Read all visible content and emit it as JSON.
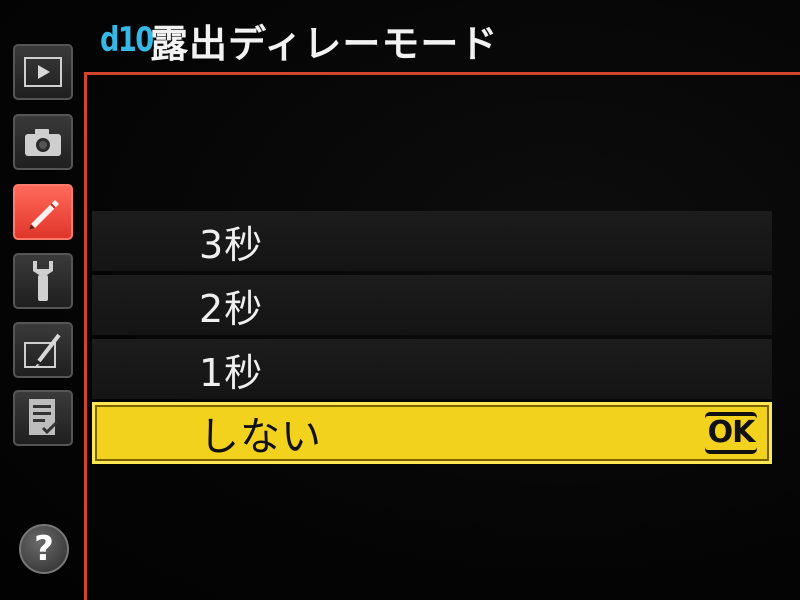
{
  "header": {
    "menu_code": "d10",
    "title": "露出ディレーモード"
  },
  "sidebar": {
    "items": [
      {
        "name": "playback-tab",
        "icon": "playback-icon",
        "active": false
      },
      {
        "name": "shooting-tab",
        "icon": "camera-icon",
        "active": false
      },
      {
        "name": "custom-settings-tab",
        "icon": "pencil-icon",
        "active": true
      },
      {
        "name": "setup-tab",
        "icon": "wrench-icon",
        "active": false
      },
      {
        "name": "retouch-tab",
        "icon": "retouch-brush-icon",
        "active": false
      },
      {
        "name": "my-menu-tab",
        "icon": "checklist-icon",
        "active": false
      }
    ],
    "help_label": "?"
  },
  "options": [
    {
      "label": "3秒",
      "selected": false
    },
    {
      "label": "2秒",
      "selected": false
    },
    {
      "label": "1秒",
      "selected": false
    },
    {
      "label": "しない",
      "selected": true
    }
  ],
  "ok_label": "OK",
  "colors": {
    "accent_frame": "#d2452c",
    "menu_code": "#35b8e6",
    "selection": "#f2d21c",
    "active_tab": "#e0352a"
  }
}
